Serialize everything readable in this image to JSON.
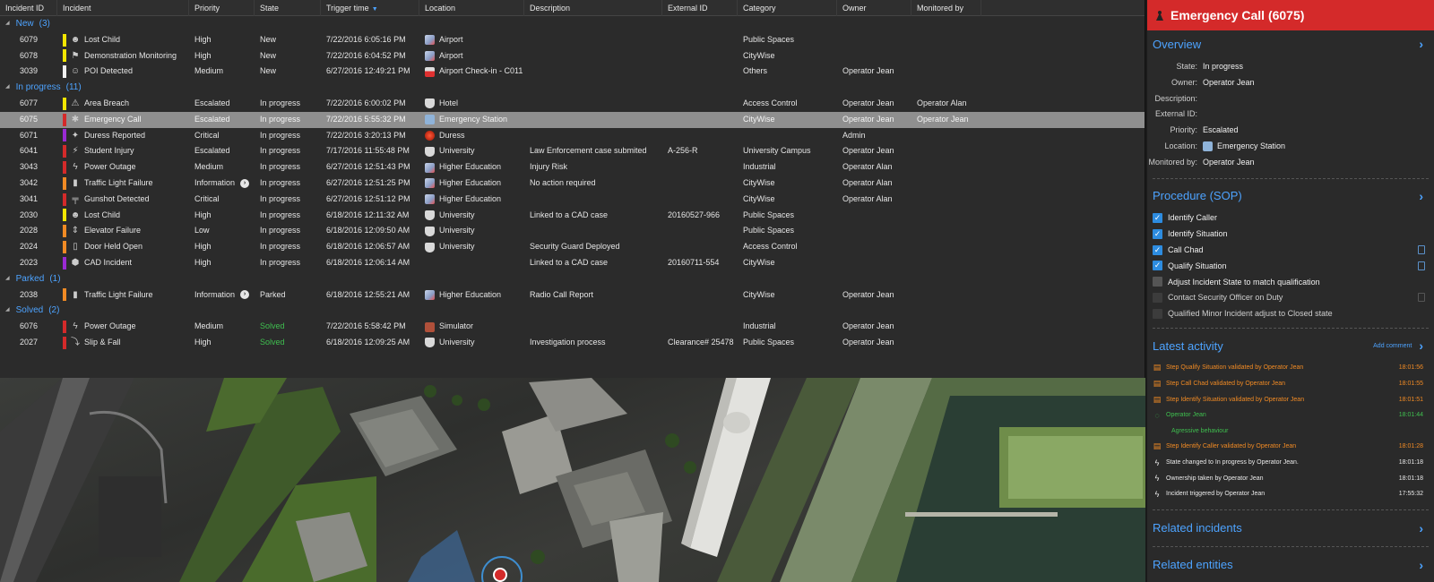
{
  "columns": [
    "Incident ID",
    "Incident",
    "Priority",
    "State",
    "Trigger time",
    "Location",
    "Description",
    "External ID",
    "Category",
    "Owner",
    "Monitored by"
  ],
  "groups": [
    {
      "name": "New",
      "count": "(3)",
      "rows": [
        {
          "id": "6079",
          "incident": "Lost Child",
          "priority": "High",
          "state": "New",
          "time": "7/22/2016 6:05:16 PM",
          "location": "Airport",
          "description": "",
          "external": "",
          "category": "Public Spaces",
          "owner": "",
          "monitored": "",
          "bar": "#f2e600",
          "icon": "child-icon",
          "loc_icon": "airport-icon"
        },
        {
          "id": "6078",
          "incident": "Demonstration Monitoring",
          "priority": "High",
          "state": "New",
          "time": "7/22/2016 6:04:52 PM",
          "location": "Airport",
          "description": "",
          "external": "",
          "category": "CityWise",
          "owner": "",
          "monitored": "",
          "bar": "#f2e600",
          "icon": "crowd-icon",
          "loc_icon": "airport-icon"
        },
        {
          "id": "3039",
          "incident": "POI Detected",
          "priority": "Medium",
          "state": "New",
          "time": "6/27/2016 12:49:21 PM",
          "location": "Airport Check-in - C011",
          "description": "",
          "external": "",
          "category": "Others",
          "owner": "Operator Jean",
          "monitored": "",
          "bar": "#f0f0f0",
          "icon": "person-icon",
          "loc_icon": "camera-icon"
        }
      ]
    },
    {
      "name": "In progress",
      "count": "(11)",
      "rows": [
        {
          "id": "6077",
          "incident": "Area Breach",
          "priority": "Escalated",
          "state": "In progress",
          "time": "7/22/2016 6:00:02 PM",
          "location": "Hotel",
          "description": "",
          "external": "",
          "category": "Access Control",
          "owner": "Operator Jean",
          "monitored": "Operator Alan",
          "bar": "#f2e600",
          "icon": "breach-icon",
          "loc_icon": "shield-icon"
        },
        {
          "id": "6075",
          "incident": "Emergency Call",
          "priority": "Escalated",
          "state": "In progress",
          "time": "7/22/2016 5:55:32 PM",
          "location": "Emergency Station",
          "description": "",
          "external": "",
          "category": "CityWise",
          "owner": "Operator Jean",
          "monitored": "Operator Jean",
          "bar": "#d42a2a",
          "icon": "siren-icon",
          "loc_icon": "station-icon",
          "selected": true
        },
        {
          "id": "6071",
          "incident": "Duress Reported",
          "priority": "Critical",
          "state": "In progress",
          "time": "7/22/2016 3:20:13 PM",
          "location": "Duress",
          "description": "",
          "external": "",
          "category": "",
          "owner": "Admin",
          "monitored": "",
          "bar": "#9a2ad4",
          "icon": "shield-person-icon",
          "loc_icon": "alarm-icon"
        },
        {
          "id": "6041",
          "incident": "Student Injury",
          "priority": "Escalated",
          "state": "In progress",
          "time": "7/17/2016 11:55:48 PM",
          "location": "University",
          "description": "Law Enforcement case submited",
          "external": "A-256-R",
          "category": "University Campus",
          "owner": "Operator Jean",
          "monitored": "",
          "bar": "#d42a2a",
          "icon": "lightning-icon",
          "loc_icon": "shield-icon"
        },
        {
          "id": "3043",
          "incident": "Power Outage",
          "priority": "Medium",
          "state": "In progress",
          "time": "6/27/2016 12:51:43 PM",
          "location": "Higher Education",
          "description": "Injury Risk",
          "external": "",
          "category": "Industrial",
          "owner": "Operator Alan",
          "monitored": "",
          "bar": "#d42a2a",
          "icon": "bolt-icon",
          "loc_icon": "airport-icon"
        },
        {
          "id": "3042",
          "incident": "Traffic Light Failure",
          "priority": "Information",
          "state": "In progress",
          "time": "6/27/2016 12:51:25 PM",
          "location": "Higher Education",
          "description": "No action required",
          "external": "",
          "category": "CityWise",
          "owner": "Operator Alan",
          "monitored": "",
          "bar": "#f08a24",
          "icon": "traffic-light-icon",
          "loc_icon": "airport-icon",
          "info": true
        },
        {
          "id": "3041",
          "incident": "Gunshot Detected",
          "priority": "Critical",
          "state": "In progress",
          "time": "6/27/2016 12:51:12 PM",
          "location": "Higher Education",
          "description": "",
          "external": "",
          "category": "CityWise",
          "owner": "Operator Alan",
          "monitored": "",
          "bar": "#d42a2a",
          "icon": "gun-icon",
          "loc_icon": "airport-icon"
        },
        {
          "id": "2030",
          "incident": "Lost Child",
          "priority": "High",
          "state": "In progress",
          "time": "6/18/2016 12:11:32 AM",
          "location": "University",
          "description": "Linked to a CAD case",
          "external": "20160527-966",
          "category": "Public Spaces",
          "owner": "",
          "monitored": "",
          "bar": "#f2e600",
          "icon": "child-icon",
          "loc_icon": "shield-icon"
        },
        {
          "id": "2028",
          "incident": "Elevator Failure",
          "priority": "Low",
          "state": "In progress",
          "time": "6/18/2016 12:09:50 AM",
          "location": "University",
          "description": "",
          "external": "",
          "category": "Public Spaces",
          "owner": "",
          "monitored": "",
          "bar": "#f08a24",
          "icon": "elevator-icon",
          "loc_icon": "shield-icon"
        },
        {
          "id": "2024",
          "incident": "Door Held Open",
          "priority": "High",
          "state": "In progress",
          "time": "6/18/2016 12:06:57 AM",
          "location": "University",
          "description": "Security Guard Deployed",
          "external": "",
          "category": "Access Control",
          "owner": "",
          "monitored": "",
          "bar": "#f08a24",
          "icon": "door-icon",
          "loc_icon": "shield-icon"
        },
        {
          "id": "2023",
          "incident": "CAD Incident",
          "priority": "High",
          "state": "In progress",
          "time": "6/18/2016 12:06:14 AM",
          "location": "",
          "description": "Linked to a CAD case",
          "external": "20160711-554",
          "category": "CityWise",
          "owner": "",
          "monitored": "",
          "bar": "#9a2ad4",
          "icon": "cad-icon",
          "loc_icon": ""
        }
      ]
    },
    {
      "name": "Parked",
      "count": "(1)",
      "rows": [
        {
          "id": "2038",
          "incident": "Traffic Light Failure",
          "priority": "Information",
          "state": "Parked",
          "time": "6/18/2016 12:55:21 AM",
          "location": "Higher Education",
          "description": "Radio Call Report",
          "external": "",
          "category": "CityWise",
          "owner": "Operator Jean",
          "monitored": "",
          "bar": "#f08a24",
          "icon": "traffic-light-icon",
          "loc_icon": "airport-icon",
          "info": true
        }
      ]
    },
    {
      "name": "Solved",
      "count": "(2)",
      "rows": [
        {
          "id": "6076",
          "incident": "Power Outage",
          "priority": "Medium",
          "state": "Solved",
          "time": "7/22/2016 5:58:42 PM",
          "location": "Simulator",
          "description": "",
          "external": "",
          "category": "Industrial",
          "owner": "Operator Jean",
          "monitored": "",
          "bar": "#d42a2a",
          "icon": "bolt-icon",
          "loc_icon": "simulator-icon"
        },
        {
          "id": "2027",
          "incident": "Slip & Fall",
          "priority": "High",
          "state": "Solved",
          "time": "6/18/2016 12:09:25 AM",
          "location": "University",
          "description": "Investigation process",
          "external": "Clearance# 25478",
          "category": "Public Spaces",
          "owner": "Operator Jean",
          "monitored": "",
          "bar": "#d42a2a",
          "icon": "fall-icon",
          "loc_icon": "shield-icon"
        }
      ]
    }
  ],
  "detail": {
    "title": "Emergency Call (6075)",
    "overview_label": "Overview",
    "fields": [
      {
        "k": "State:",
        "v": "In progress"
      },
      {
        "k": "Owner:",
        "v": "Operator Jean"
      },
      {
        "k": "Description:",
        "v": ""
      },
      {
        "k": "External ID:",
        "v": ""
      },
      {
        "k": "Priority:",
        "v": "Escalated"
      },
      {
        "k": "Location:",
        "v": "Emergency Station",
        "icon": true
      },
      {
        "k": "Monitored by:",
        "v": "Operator Jean"
      }
    ],
    "procedure_label": "Procedure (SOP)",
    "sop": [
      {
        "label": "Identify Caller",
        "checked": true,
        "doc": false
      },
      {
        "label": "Identify Situation",
        "checked": true,
        "doc": false
      },
      {
        "label": "Call Chad",
        "checked": true,
        "doc": true
      },
      {
        "label": "Qualify Situation",
        "checked": true,
        "doc": true
      },
      {
        "label": "Adjust Incident State to match qualification",
        "checked": false,
        "doc": false
      },
      {
        "label": "Contact Security Officer on Duty",
        "checked": false,
        "doc": true,
        "dim": true
      },
      {
        "label": "Qualified Minor Incident adjust to Closed state",
        "checked": false,
        "doc": false,
        "dim": true
      }
    ],
    "activity_label": "Latest activity",
    "add_comment": "Add comment",
    "activity": [
      {
        "text": "Step Qualify Situation validated by Operator Jean",
        "time": "18:01:56",
        "kind": "orange"
      },
      {
        "text": "Step Call Chad validated by Operator Jean",
        "time": "18:01:55",
        "kind": "orange"
      },
      {
        "text": "Step Identify Situation validated by Operator Jean",
        "time": "18:01:51",
        "kind": "orange"
      },
      {
        "text": "Operator Jean",
        "time": "18:01:44",
        "kind": "green"
      },
      {
        "text": "Agressive behaviour",
        "time": "",
        "kind": "green-sub"
      },
      {
        "text": "Step Identify Caller validated by Operator Jean",
        "time": "18:01:28",
        "kind": "orange"
      },
      {
        "text": "State changed to In progress by Operator Jean.",
        "time": "18:01:18",
        "kind": "white"
      },
      {
        "text": "Ownership taken by Operator Jean",
        "time": "18:01:18",
        "kind": "white"
      },
      {
        "text": "Incident triggered by Operator Jean",
        "time": "17:55:32",
        "kind": "white"
      }
    ],
    "related_incidents_label": "Related incidents",
    "related_entities_label": "Related entities"
  }
}
